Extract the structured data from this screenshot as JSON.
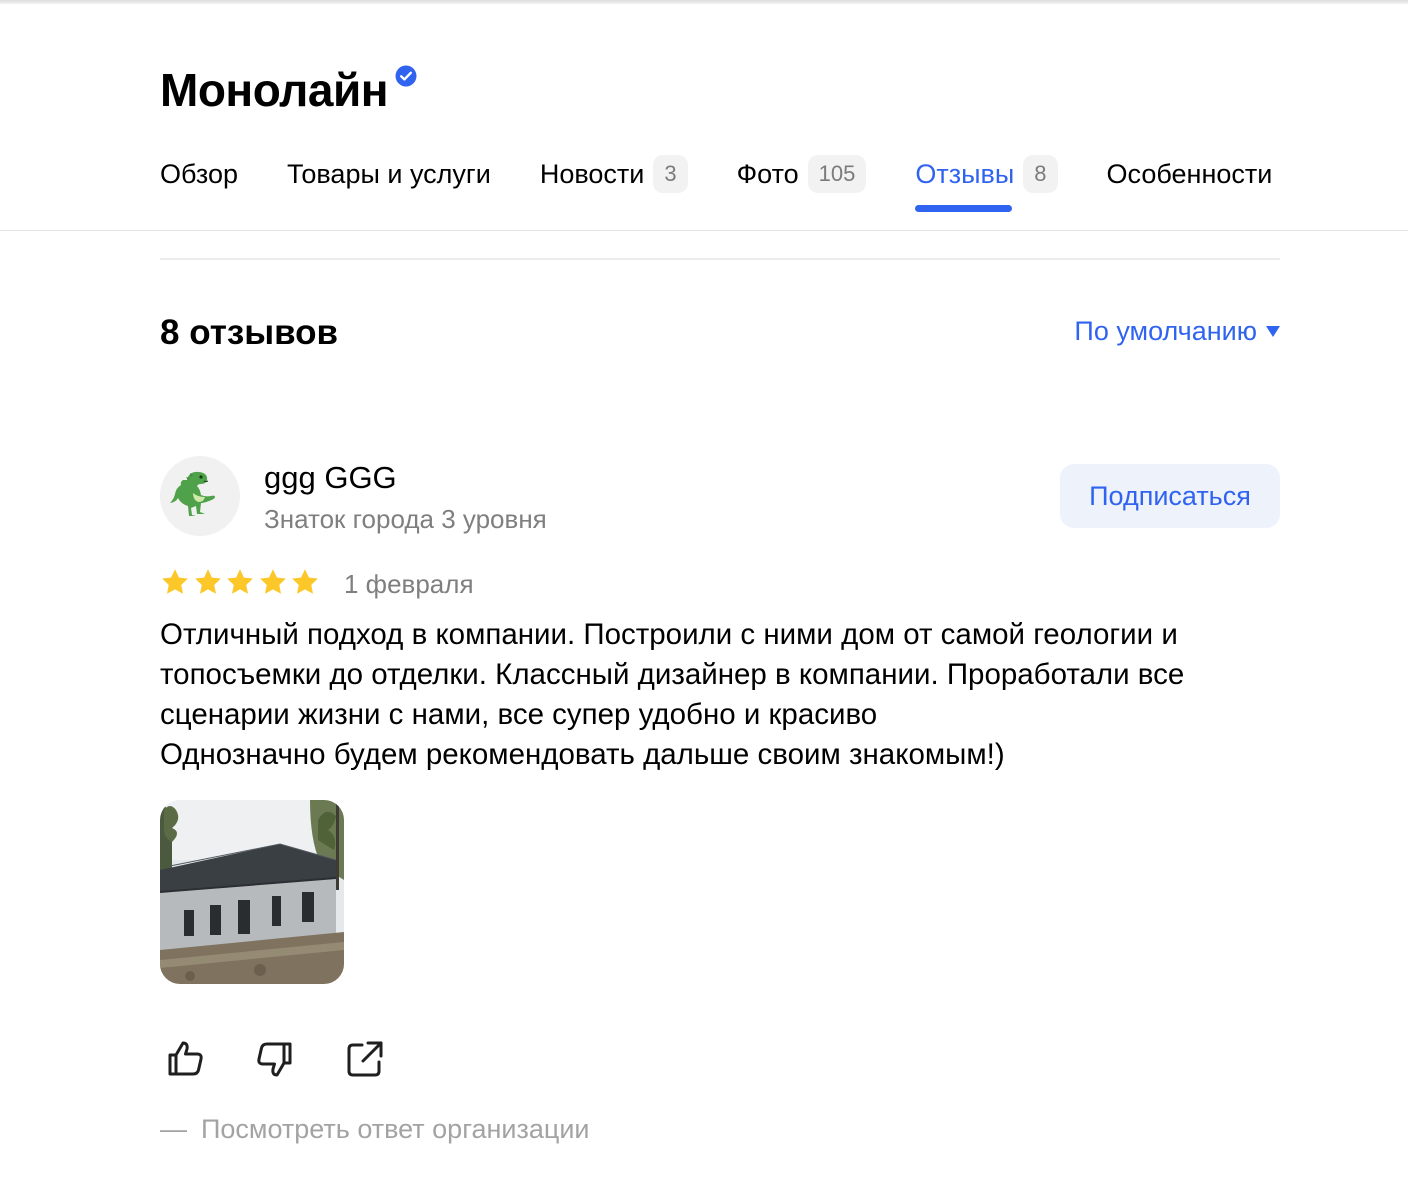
{
  "organization": {
    "name": "Монолайн",
    "verified_icon": "verified-check-icon"
  },
  "tabs": [
    {
      "label": "Обзор"
    },
    {
      "label": "Товары и услуги"
    },
    {
      "label": "Новости",
      "count": "3"
    },
    {
      "label": "Фото",
      "count": "105"
    },
    {
      "label": "Отзывы",
      "count": "8",
      "active": true
    },
    {
      "label": "Особенности"
    }
  ],
  "reviews": {
    "count_heading": "8 отзывов",
    "sort_label": "По умолчанию",
    "items": [
      {
        "author_name": "ggg GGG",
        "author_level": "Знаток города 3 уровня",
        "avatar_icon": "dinosaur-icon",
        "subscribe_label": "Подписаться",
        "rating": 5,
        "date": "1 февраля",
        "text_lines": [
          "Отличный подход в компании. Построили с ними дом от самой геологии и",
          "топосъемки до отделки. Классный дизайнер в компании. Проработали все",
          "сценарии жизни с нами, все супер удобно и красиво",
          "Однозначно будем рекомендовать дальше своим знакомым!)"
        ],
        "photo_count": 1,
        "actions": [
          "thumbs-up-icon",
          "thumbs-down-icon",
          "share-icon"
        ],
        "org_answer_dash": "—",
        "org_answer_label": "Посмотреть ответ организации"
      }
    ]
  },
  "colors": {
    "accent": "#3064f0",
    "star": "#fcc728",
    "muted": "#7f7f7f",
    "answer_link": "#a3a3a3"
  }
}
